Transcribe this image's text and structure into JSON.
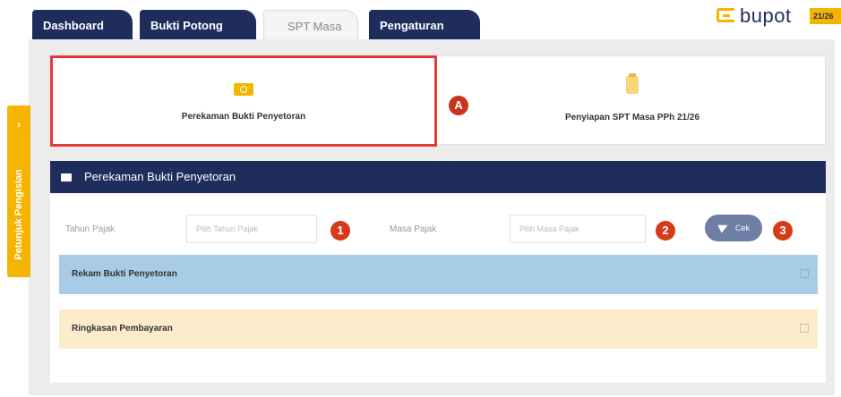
{
  "tabs": [
    {
      "label": "Dashboard"
    },
    {
      "label": "Bukti Potong"
    },
    {
      "label": "SPT Masa"
    },
    {
      "label": "Pengaturan"
    }
  ],
  "logo": {
    "text": "bupot",
    "badge": "21/26"
  },
  "side_tab": {
    "label": "Petunjuk Pengisian",
    "chevron": "›"
  },
  "cards": [
    {
      "label": "Perekaman Bukti Penyetoran",
      "icon": "camera-icon"
    },
    {
      "label": "Penyiapan SPT Masa PPh 21/26",
      "icon": "clipboard-icon"
    }
  ],
  "markers": {
    "a": "A",
    "one": "1",
    "two": "2",
    "three": "3"
  },
  "section": {
    "title": "Perekaman Bukti Penyetoran"
  },
  "form": {
    "tahun_label": "Tahun Pajak",
    "tahun_placeholder": "Pilih Tahun Pajak",
    "masa_label": "Masa Pajak",
    "masa_placeholder": "Pilih Masa Pajak",
    "cek_label": "Cek"
  },
  "bars": {
    "rekam": "Rekam Bukti Penyetoran",
    "ringkasan": "Ringkasan Pembayaran"
  },
  "colors": {
    "navy": "#1f2d5c",
    "accent": "#f4b400",
    "highlight_red": "#e53935",
    "marker": "#d63a1a",
    "blue_bar": "#a8cbe6",
    "peach_bar": "#fdeccc"
  }
}
